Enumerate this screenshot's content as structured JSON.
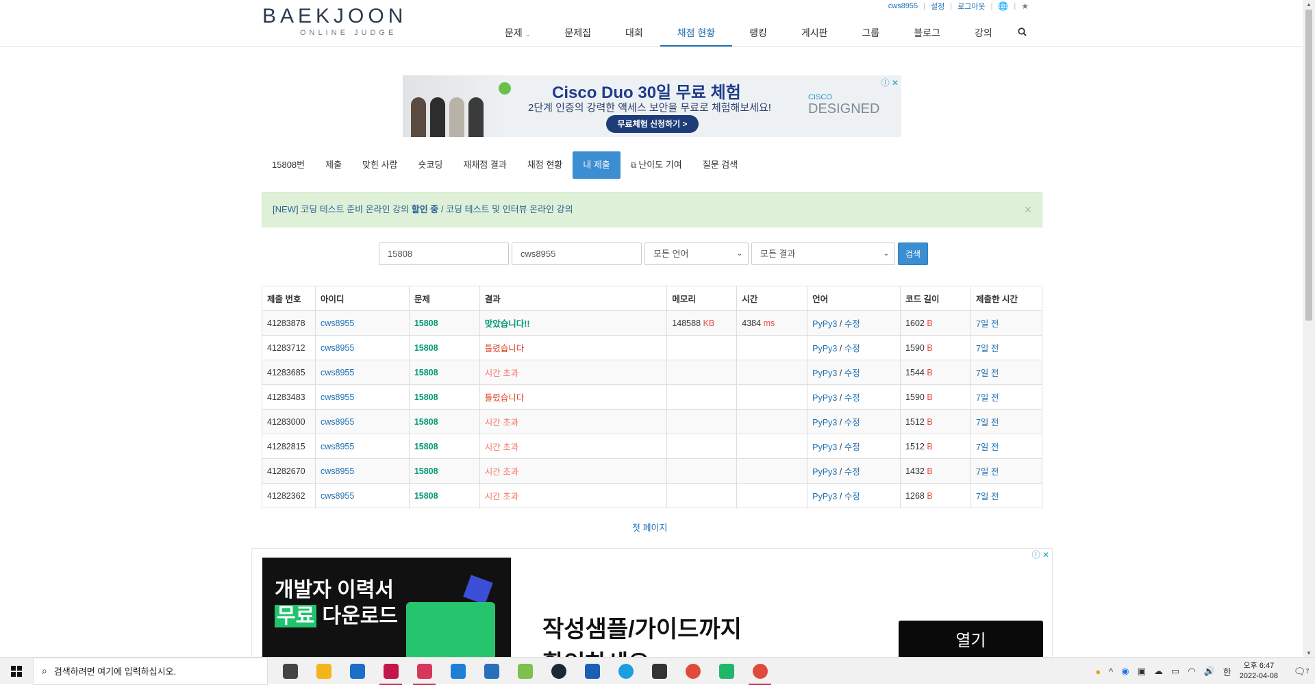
{
  "header": {
    "logo_main": "BAEKJOON",
    "logo_sub": "ONLINE JUDGE",
    "util": {
      "user": "cws8955",
      "settings": "설정",
      "logout": "로그아웃"
    },
    "nav": [
      {
        "label": "문제",
        "has_dropdown": true,
        "active": false
      },
      {
        "label": "문제집",
        "active": false
      },
      {
        "label": "대회",
        "active": false
      },
      {
        "label": "채점 현황",
        "active": true
      },
      {
        "label": "랭킹",
        "active": false
      },
      {
        "label": "게시판",
        "active": false
      },
      {
        "label": "그룹",
        "active": false
      },
      {
        "label": "블로그",
        "active": false
      },
      {
        "label": "강의",
        "active": false
      }
    ]
  },
  "ad_top": {
    "title": "Cisco Duo 30일 무료 체험",
    "desc": "2단계 인증의 강력한 액세스 보안을 무료로 체험해보세요!",
    "cta": "무료체험 신청하기 >",
    "brand_small": "CISCO",
    "brand_big": "DESIGNED"
  },
  "tabs": [
    {
      "label": "15808번",
      "active": false
    },
    {
      "label": "제출",
      "active": false
    },
    {
      "label": "맞힌 사람",
      "active": false
    },
    {
      "label": "숏코딩",
      "active": false
    },
    {
      "label": "재채점 결과",
      "active": false
    },
    {
      "label": "채점 현황",
      "active": false
    },
    {
      "label": "내 제출",
      "active": true
    },
    {
      "label": "난이도 기여",
      "active": false,
      "external": true
    },
    {
      "label": "질문 검색",
      "active": false
    }
  ],
  "notice": {
    "prefix": "[NEW] 코딩 테스트 준비 온라인 강의 ",
    "bold": "할인 중",
    "suffix": " / 코딩 테스트 및 인터뷰 온라인 강의",
    "close": "×"
  },
  "filter": {
    "problem_id": "15808",
    "user_id": "cws8955",
    "language": "모든 언어",
    "result": "모든 결과",
    "search_label": "검색"
  },
  "table": {
    "headers": [
      "제출 번호",
      "아이디",
      "문제",
      "결과",
      "메모리",
      "시간",
      "언어",
      "코드 길이",
      "제출한 시간"
    ],
    "rows": [
      {
        "id": "41283878",
        "user": "cws8955",
        "problem": "15808",
        "result": "맞았습니다!!",
        "result_type": "ac",
        "memory": "148588",
        "memory_unit": "KB",
        "time": "4384",
        "time_unit": "ms",
        "lang": "PyPy3",
        "edit": "수정",
        "code_len": "1602",
        "code_unit": "B",
        "submitted": "7일 전"
      },
      {
        "id": "41283712",
        "user": "cws8955",
        "problem": "15808",
        "result": "틀렸습니다",
        "result_type": "wa",
        "memory": "",
        "memory_unit": "",
        "time": "",
        "time_unit": "",
        "lang": "PyPy3",
        "edit": "수정",
        "code_len": "1590",
        "code_unit": "B",
        "submitted": "7일 전"
      },
      {
        "id": "41283685",
        "user": "cws8955",
        "problem": "15808",
        "result": "시간 초과",
        "result_type": "tle",
        "memory": "",
        "memory_unit": "",
        "time": "",
        "time_unit": "",
        "lang": "PyPy3",
        "edit": "수정",
        "code_len": "1544",
        "code_unit": "B",
        "submitted": "7일 전"
      },
      {
        "id": "41283483",
        "user": "cws8955",
        "problem": "15808",
        "result": "틀렸습니다",
        "result_type": "wa",
        "memory": "",
        "memory_unit": "",
        "time": "",
        "time_unit": "",
        "lang": "PyPy3",
        "edit": "수정",
        "code_len": "1590",
        "code_unit": "B",
        "submitted": "7일 전"
      },
      {
        "id": "41283000",
        "user": "cws8955",
        "problem": "15808",
        "result": "시간 초과",
        "result_type": "tle",
        "memory": "",
        "memory_unit": "",
        "time": "",
        "time_unit": "",
        "lang": "PyPy3",
        "edit": "수정",
        "code_len": "1512",
        "code_unit": "B",
        "submitted": "7일 전"
      },
      {
        "id": "41282815",
        "user": "cws8955",
        "problem": "15808",
        "result": "시간 초과",
        "result_type": "tle",
        "memory": "",
        "memory_unit": "",
        "time": "",
        "time_unit": "",
        "lang": "PyPy3",
        "edit": "수정",
        "code_len": "1512",
        "code_unit": "B",
        "submitted": "7일 전"
      },
      {
        "id": "41282670",
        "user": "cws8955",
        "problem": "15808",
        "result": "시간 초과",
        "result_type": "tle",
        "memory": "",
        "memory_unit": "",
        "time": "",
        "time_unit": "",
        "lang": "PyPy3",
        "edit": "수정",
        "code_len": "1432",
        "code_unit": "B",
        "submitted": "7일 전"
      },
      {
        "id": "41282362",
        "user": "cws8955",
        "problem": "15808",
        "result": "시간 초과",
        "result_type": "tle",
        "memory": "",
        "memory_unit": "",
        "time": "",
        "time_unit": "",
        "lang": "PyPy3",
        "edit": "수정",
        "code_len": "1268",
        "code_unit": "B",
        "submitted": "7일 전"
      }
    ]
  },
  "pagination": {
    "first_page": "첫 페이지"
  },
  "ad_bottom": {
    "line1": "개발자 이력서",
    "highlight": "무료",
    "line2_rest": " 다운로드",
    "headline": "작성샘플/가이드까지",
    "headline2": "확인하세요",
    "cta": "열기"
  },
  "taskbar": {
    "search_placeholder": "검색하려면 여기에 입력하십시오.",
    "ime": "한",
    "time": "오후 6:47",
    "date": "2022-04-08",
    "notification_count": "7",
    "apps": [
      {
        "icon": "task-view-icon",
        "color": "#444"
      },
      {
        "icon": "file-explorer-icon",
        "color": "#f2b51c"
      },
      {
        "icon": "store-icon",
        "color": "#1b6fc9"
      },
      {
        "icon": "app-red-icon",
        "color": "#c5164b"
      },
      {
        "icon": "sync-app-icon",
        "color": "#d9365b"
      },
      {
        "icon": "mail-icon",
        "color": "#1d7fd6"
      },
      {
        "icon": "network-app-icon",
        "color": "#2a6fba"
      },
      {
        "icon": "paint-app-icon",
        "color": "#7cc04e"
      },
      {
        "icon": "steam-icon",
        "color": "#1b2838"
      },
      {
        "icon": "reader-icon",
        "color": "#1a5fb4"
      },
      {
        "icon": "edge-icon",
        "color": "#1aa0e0"
      },
      {
        "icon": "typora-icon",
        "color": "#333"
      },
      {
        "icon": "chrome-icon",
        "color": "#e04a3b"
      },
      {
        "icon": "app-green-icon",
        "color": "#1fb86a"
      },
      {
        "icon": "chrome-icon",
        "color": "#e04a3b"
      }
    ]
  }
}
